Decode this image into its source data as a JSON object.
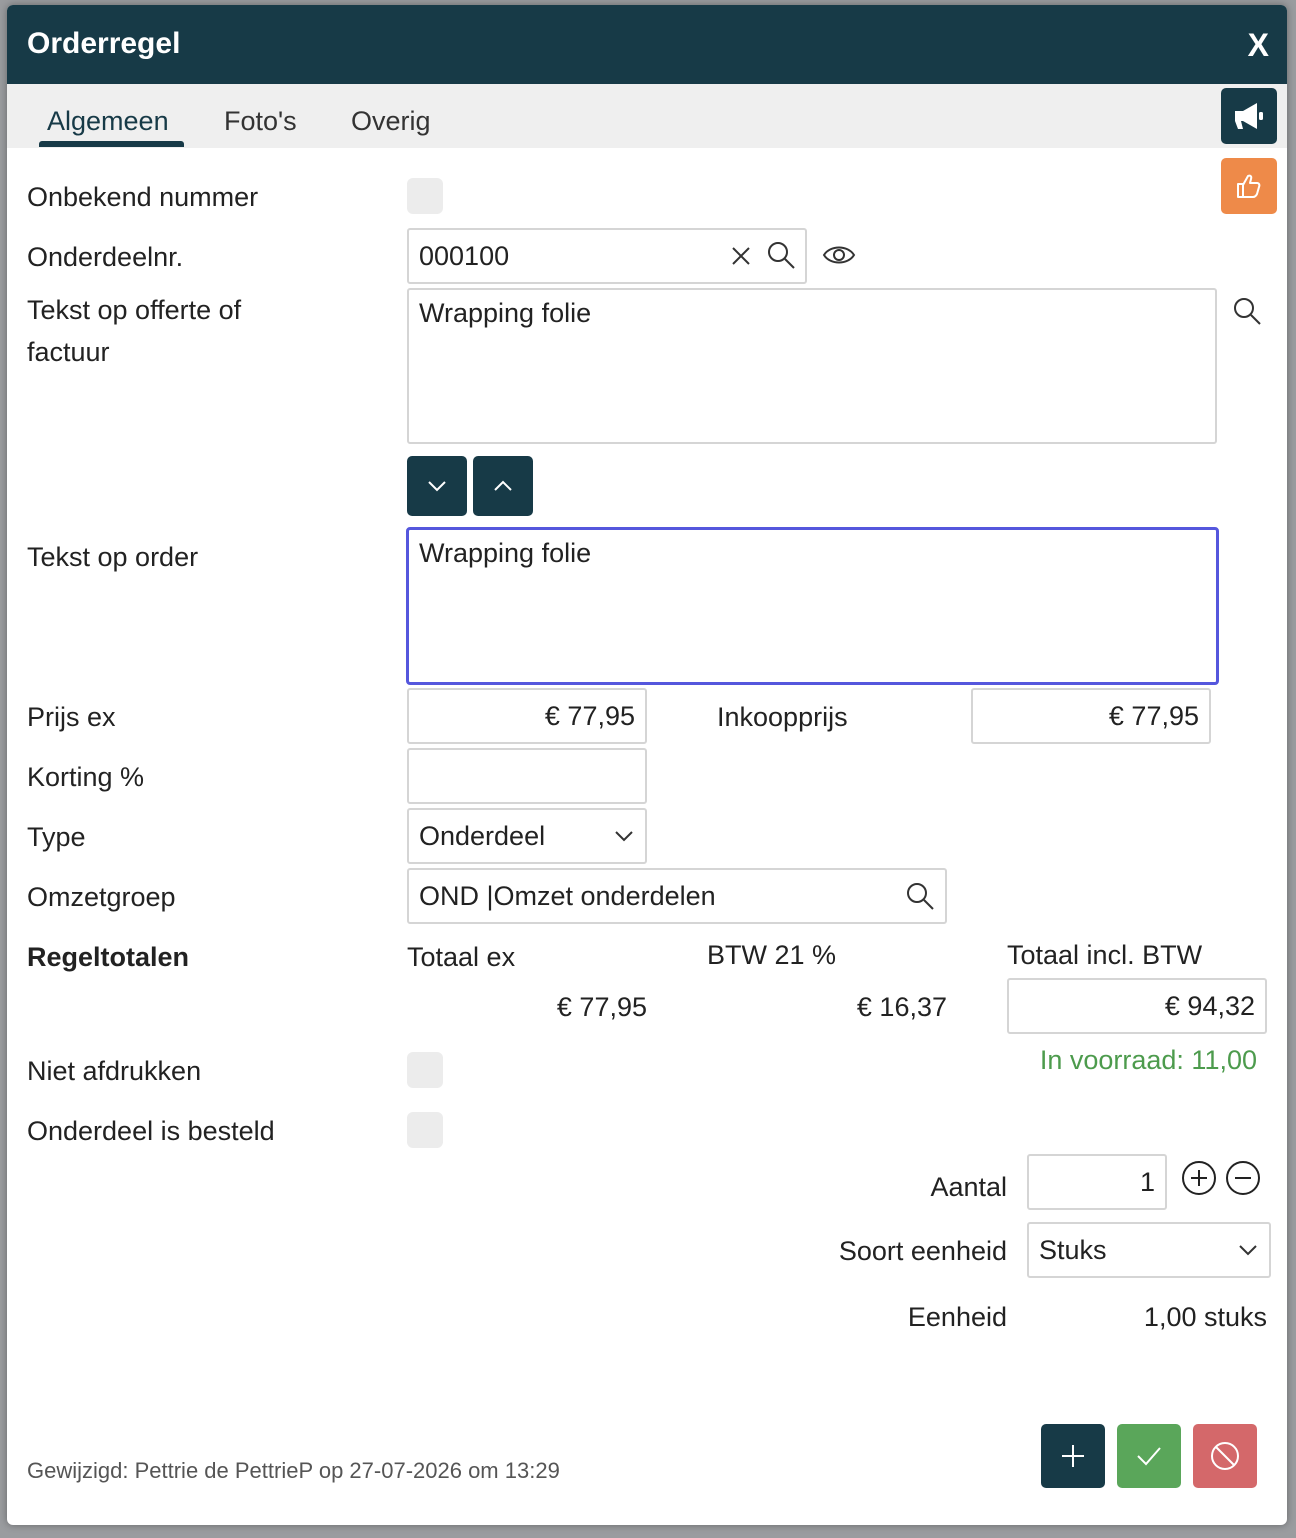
{
  "dialog": {
    "title": "Orderregel",
    "close_label": "X"
  },
  "tabs": [
    {
      "label": "Algemeen",
      "active": true
    },
    {
      "label": "Foto's",
      "active": false
    },
    {
      "label": "Overig",
      "active": false
    }
  ],
  "side_buttons": {
    "announce_icon": "megaphone-icon",
    "feedback_icon": "thumbs-up-icon"
  },
  "form": {
    "onbekend_nummer": {
      "label": "Onbekend nummer",
      "checked": false
    },
    "onderdeelnr": {
      "label": "Onderdeelnr.",
      "value": "000100"
    },
    "tekst_offerte": {
      "label": "Tekst op offerte of factuur",
      "value": "Wrapping folie"
    },
    "tekst_order": {
      "label": "Tekst op order",
      "value": "Wrapping folie"
    },
    "prijs_ex": {
      "label": "Prijs ex",
      "value": "€ 77,95"
    },
    "inkoopprijs": {
      "label": "Inkoopprijs",
      "value": "€ 77,95"
    },
    "korting": {
      "label": "Korting %",
      "value": ""
    },
    "type": {
      "label": "Type",
      "value": "Onderdeel"
    },
    "omzetgroep": {
      "label": "Omzetgroep",
      "value": "OND |Omzet onderdelen"
    },
    "regeltotalen": {
      "label": "Regeltotalen",
      "totaal_ex_label": "Totaal ex",
      "btw_label": "BTW 21 %",
      "totaal_incl_label": "Totaal incl. BTW",
      "totaal_ex": "€ 77,95",
      "btw": "€ 16,37",
      "totaal_incl": "€ 94,32"
    },
    "voorraad": "In voorraad: 11,00",
    "niet_afdrukken": {
      "label": "Niet afdrukken",
      "checked": false
    },
    "besteld": {
      "label": "Onderdeel is besteld",
      "checked": false
    },
    "aantal": {
      "label": "Aantal",
      "value": "1"
    },
    "soort_eenheid": {
      "label": "Soort eenheid",
      "value": "Stuks"
    },
    "eenheid": {
      "label": "Eenheid",
      "value": "1,00 stuks"
    }
  },
  "footer": {
    "modified": "Gewijzigd: Pettrie de PettrieP op 27-07-2026 om 13:29"
  },
  "colors": {
    "header": "#173a47",
    "accent_orange": "#ee8a49",
    "confirm_green": "#5aa65a",
    "cancel_red": "#d4686a",
    "stock_green": "#4d9b4d",
    "focus_border": "#5557dd"
  }
}
